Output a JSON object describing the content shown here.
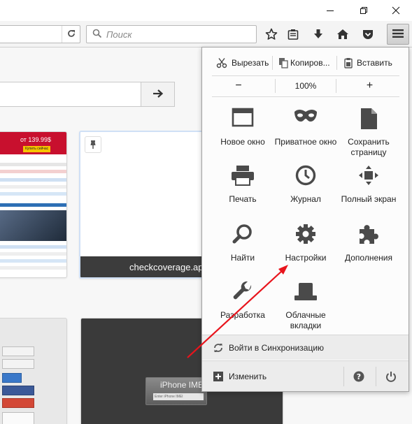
{
  "window": {
    "controls": [
      "minimize-icon",
      "restore-icon",
      "close-icon"
    ]
  },
  "toolbar": {
    "search_placeholder": "Поиск",
    "icons": [
      "bookmark-star-icon",
      "reading-list-icon",
      "download-icon",
      "home-icon",
      "pocket-icon",
      "menu-icon"
    ]
  },
  "newtab": {
    "tiles": [
      {
        "caption": "",
        "thumb_price": "от 139.99$",
        "thumb_badge": "Купить сейчас"
      },
      {
        "caption": "checkcoverage.ap"
      },
      {
        "caption": ""
      },
      {
        "caption": "",
        "thumb_title": "iPhone IME",
        "thumb_input": "Enter iPhone IMEI"
      }
    ]
  },
  "menu": {
    "edit": {
      "cut": "Вырезать",
      "copy": "Копиров...",
      "paste": "Вставить"
    },
    "zoom": {
      "out": "−",
      "level": "100%",
      "in": "+"
    },
    "items": [
      {
        "label": "Новое окно",
        "icon": "new-window-icon"
      },
      {
        "label": "Приватное окно",
        "icon": "private-mask-icon"
      },
      {
        "label": "Сохранить страницу",
        "icon": "save-page-icon"
      },
      {
        "label": "Печать",
        "icon": "print-icon"
      },
      {
        "label": "Журнал",
        "icon": "history-clock-icon"
      },
      {
        "label": "Полный экран",
        "icon": "fullscreen-icon"
      },
      {
        "label": "Найти",
        "icon": "find-icon"
      },
      {
        "label": "Настройки",
        "icon": "settings-gear-icon"
      },
      {
        "label": "Дополнения",
        "icon": "addons-puzzle-icon"
      },
      {
        "label": "Разработка",
        "icon": "developer-wrench-icon"
      },
      {
        "label": "Облачные вкладки",
        "icon": "cloud-tabs-icon"
      }
    ],
    "sync": "Войти в Синхронизацию",
    "customize": "Изменить"
  },
  "annotation": {
    "arrow_color": "#e8141c"
  }
}
